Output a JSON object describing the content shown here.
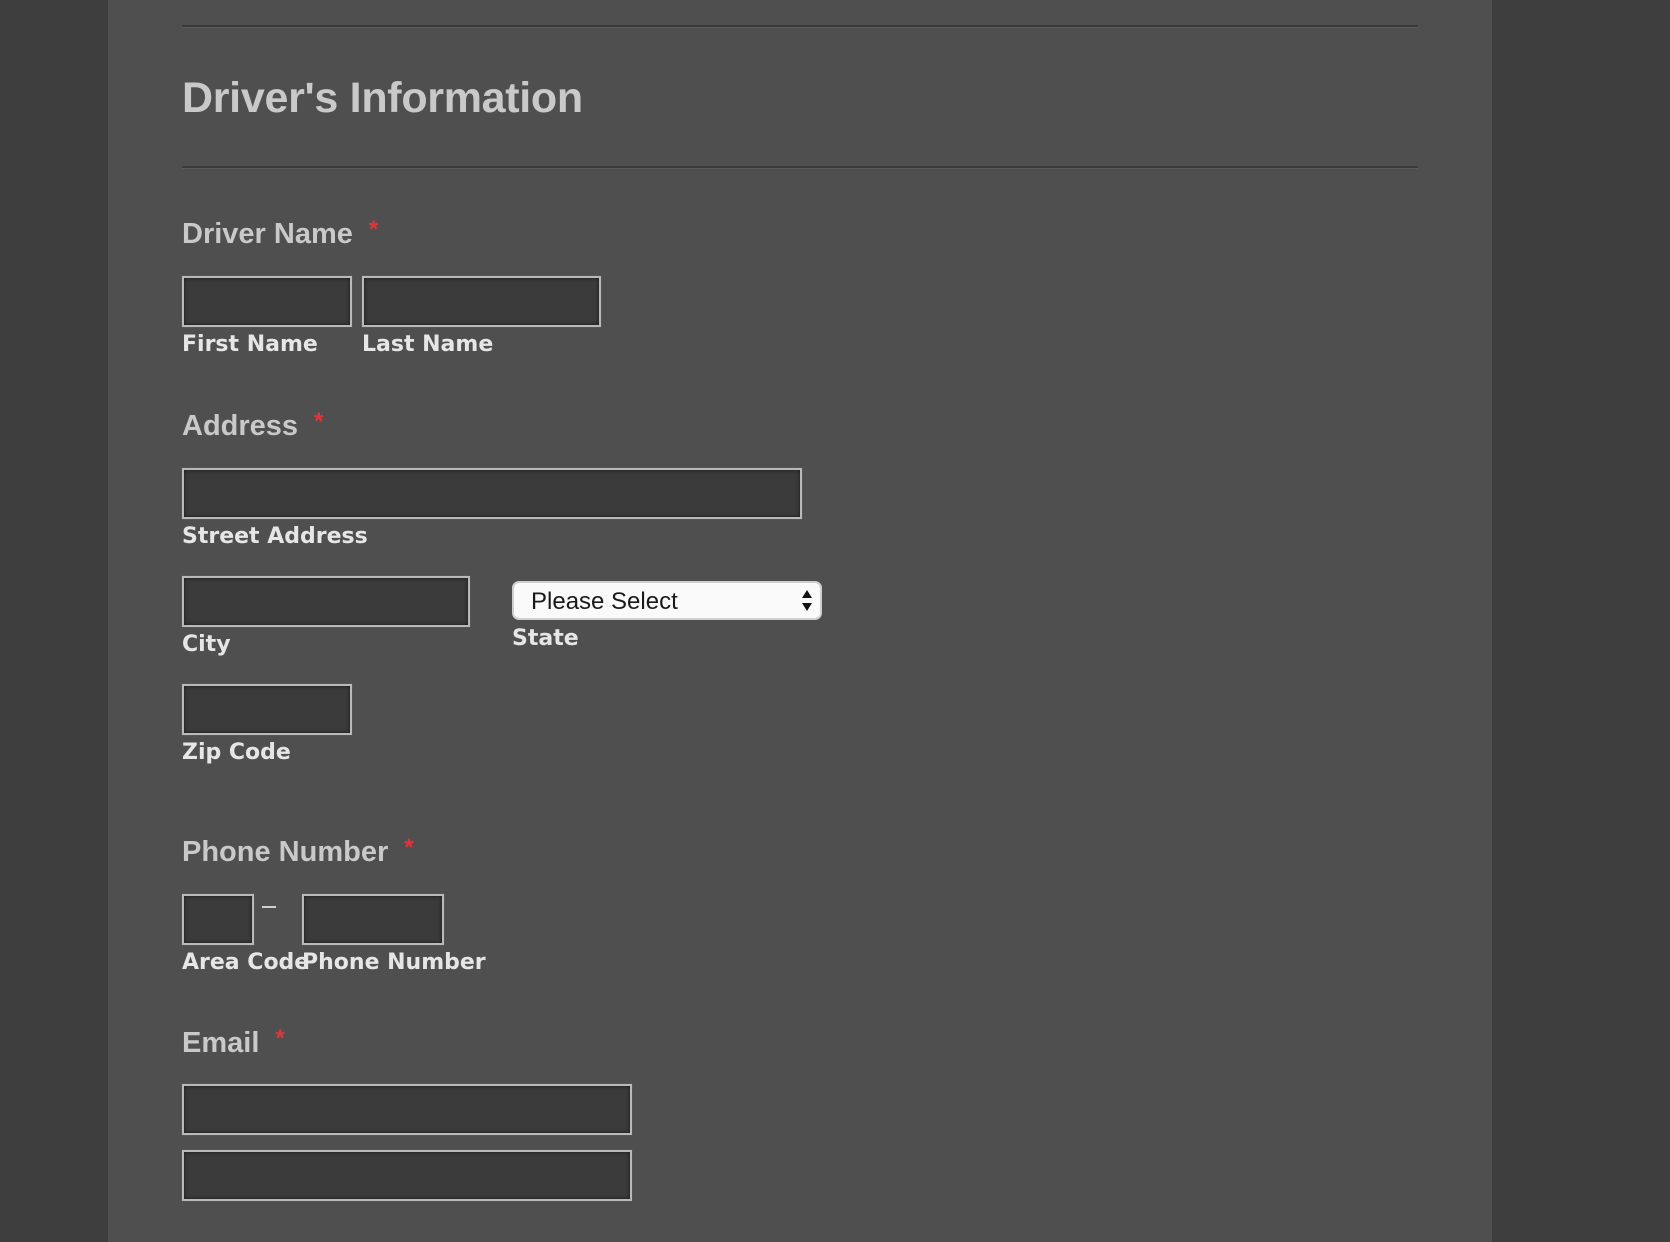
{
  "section": {
    "title": "Driver's Information"
  },
  "fields": {
    "driver_name": {
      "label": "Driver Name",
      "required_mark": "*",
      "first_name": {
        "value": "",
        "sublabel": "First Name"
      },
      "last_name": {
        "value": "",
        "sublabel": "Last Name"
      }
    },
    "address": {
      "label": "Address",
      "required_mark": "*",
      "street": {
        "value": "",
        "sublabel": "Street Address"
      },
      "city": {
        "value": "",
        "sublabel": "City"
      },
      "state": {
        "selected": "Please Select",
        "sublabel": "State"
      },
      "zip": {
        "value": "",
        "sublabel": "Zip Code"
      }
    },
    "phone": {
      "label": "Phone Number",
      "required_mark": "*",
      "area_code": {
        "value": "",
        "sublabel": "Area Code"
      },
      "number": {
        "value": "",
        "sublabel": "Phone Number"
      }
    },
    "email": {
      "label": "Email",
      "required_mark": "*",
      "email": {
        "value": ""
      },
      "confirm": {
        "value": ""
      }
    }
  },
  "colors": {
    "page_background": "#3e3e3e",
    "panel_background": "#4f4f4f",
    "input_background": "#3b3b3b",
    "label_text": "#c9c9c9",
    "required_star": "#e0363a"
  },
  "icons": {
    "select_arrows": "up-down-arrows-icon"
  }
}
